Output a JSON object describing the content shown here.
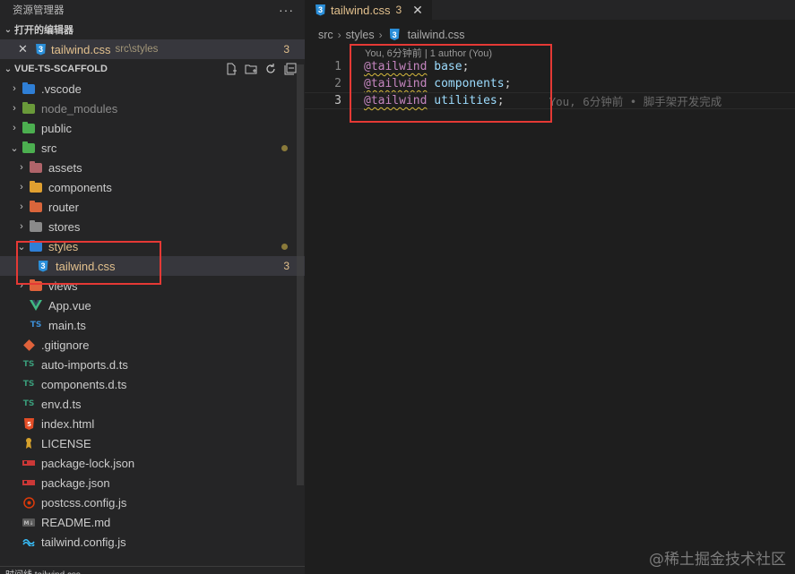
{
  "sidebar": {
    "title": "资源管理器",
    "more": "···",
    "open_editors": {
      "header": "打开的编辑器",
      "item": {
        "close": "✕",
        "name": "tailwind.css",
        "path": "src\\styles",
        "badge": "3"
      }
    },
    "project": {
      "header": "VUE-TS-SCAFFOLD",
      "items": [
        {
          "label": ".vscode",
          "type": "folder",
          "chevron": "›",
          "color": "#2f7fd6",
          "dim": false,
          "mod": false
        },
        {
          "label": "node_modules",
          "type": "folder",
          "chevron": "›",
          "color": "#6a9a3a",
          "dim": true,
          "mod": false
        },
        {
          "label": "public",
          "type": "folder",
          "chevron": "›",
          "color": "#4caf50",
          "dim": false,
          "mod": false
        },
        {
          "label": "src",
          "type": "folder",
          "chevron": "⌄",
          "color": "#4caf50",
          "dim": false,
          "mod": false,
          "dot": true
        },
        {
          "label": "assets",
          "type": "folder",
          "chevron": "›",
          "color": "#b0646a",
          "dim": false,
          "mod": false,
          "indent": 1
        },
        {
          "label": "components",
          "type": "folder",
          "chevron": "›",
          "color": "#e0a030",
          "dim": false,
          "mod": false,
          "indent": 1
        },
        {
          "label": "router",
          "type": "folder",
          "chevron": "›",
          "color": "#d9653b",
          "dim": false,
          "mod": false,
          "indent": 1
        },
        {
          "label": "stores",
          "type": "folder",
          "chevron": "›",
          "color": "#8a8a8a",
          "dim": false,
          "mod": false,
          "indent": 1
        },
        {
          "label": "styles",
          "type": "folder",
          "chevron": "⌄",
          "color": "#2f7fd6",
          "dim": false,
          "mod": true,
          "indent": 1,
          "dot": true
        },
        {
          "label": "tailwind.css",
          "type": "css",
          "chevron": "",
          "dim": false,
          "mod": true,
          "indent": 2,
          "badge": "3",
          "selected": true
        },
        {
          "label": "views",
          "type": "folder",
          "chevron": "›",
          "color": "#e0623b",
          "dim": false,
          "mod": false,
          "indent": 1
        },
        {
          "label": "App.vue",
          "type": "vue",
          "chevron": "",
          "dim": false,
          "mod": false,
          "indent": 1
        },
        {
          "label": "main.ts",
          "type": "ts",
          "chevron": "",
          "dim": false,
          "mod": false,
          "indent": 1
        },
        {
          "label": ".gitignore",
          "type": "git",
          "chevron": "",
          "dim": false,
          "mod": false
        },
        {
          "label": "auto-imports.d.ts",
          "type": "dts",
          "chevron": "",
          "dim": false,
          "mod": false
        },
        {
          "label": "components.d.ts",
          "type": "dts",
          "chevron": "",
          "dim": false,
          "mod": false
        },
        {
          "label": "env.d.ts",
          "type": "dts",
          "chevron": "",
          "dim": false,
          "mod": false
        },
        {
          "label": "index.html",
          "type": "html",
          "chevron": "",
          "dim": false,
          "mod": false
        },
        {
          "label": "LICENSE",
          "type": "license",
          "chevron": "",
          "dim": false,
          "mod": false
        },
        {
          "label": "package-lock.json",
          "type": "npm",
          "chevron": "",
          "dim": false,
          "mod": false
        },
        {
          "label": "package.json",
          "type": "npm",
          "chevron": "",
          "dim": false,
          "mod": false
        },
        {
          "label": "postcss.config.js",
          "type": "postcss",
          "chevron": "",
          "dim": false,
          "mod": false
        },
        {
          "label": "README.md",
          "type": "md",
          "chevron": "",
          "dim": false,
          "mod": false
        },
        {
          "label": "tailwind.config.js",
          "type": "tailwind",
          "chevron": "",
          "dim": false,
          "mod": false
        }
      ]
    },
    "bottom_section": "时间线 tailwind.css"
  },
  "editor": {
    "tab": {
      "name": "tailwind.css",
      "badge": "3",
      "close": "✕"
    },
    "breadcrumb": [
      "src",
      "styles",
      "tailwind.css"
    ],
    "codelens": "You, 6分钟前 | 1 author (You)",
    "lines": [
      {
        "num": "1",
        "kw": "@tailwind",
        "val": "base",
        "punc": ";"
      },
      {
        "num": "2",
        "kw": "@tailwind",
        "val": "components",
        "punc": ";"
      },
      {
        "num": "3",
        "kw": "@tailwind",
        "val": "utilities",
        "punc": ";",
        "blame": "You, 6分钟前 • 脚手架开发完成"
      }
    ]
  },
  "watermark": "@稀土掘金技术社区"
}
